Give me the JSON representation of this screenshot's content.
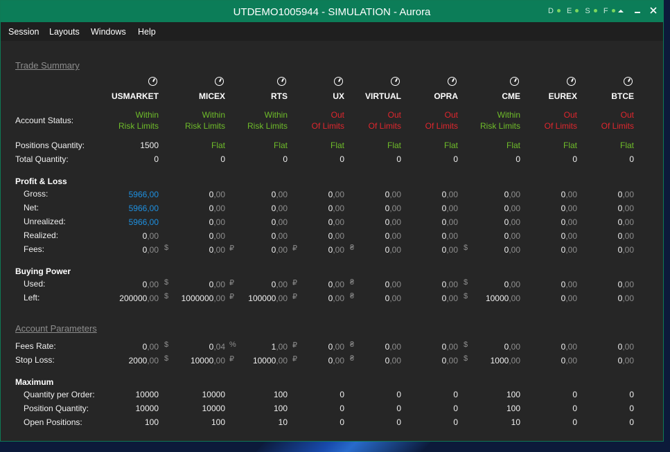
{
  "window": {
    "title": "UTDEMO1005944 - SIMULATION - Aurora",
    "lights": [
      "D",
      "E",
      "S",
      "F"
    ]
  },
  "menu": [
    "Session",
    "Layouts",
    "Windows",
    "Help"
  ],
  "sections": {
    "trade_summary": "Trade Summary",
    "account_parameters": "Account Parameters"
  },
  "exchanges": [
    "USMARKET",
    "MICEX",
    "RTS",
    "UX",
    "VIRTUAL",
    "OPRA",
    "CME",
    "EUREX",
    "BTCE"
  ],
  "labels": {
    "account_status": "Account Status:",
    "positions_quantity": "Positions Quantity:",
    "total_quantity": "Total Quantity:",
    "profit_loss": "Profit & Loss",
    "gross": "Gross:",
    "net": "Net:",
    "unrealized": "Unrealized:",
    "realized": "Realized:",
    "fees": "Fees:",
    "buying_power": "Buying Power",
    "used": "Used:",
    "left": "Left:",
    "fees_rate": "Fees Rate:",
    "stop_loss": "Stop Loss:",
    "maximum": "Maximum",
    "qty_per_order": "Quantity per Order:",
    "position_quantity": "Position Quantity:",
    "open_positions": "Open Positions:"
  },
  "account_status": [
    {
      "l1": "Within",
      "l2": "Risk Limits",
      "color": "green"
    },
    {
      "l1": "Within",
      "l2": "Risk Limits",
      "color": "green"
    },
    {
      "l1": "Within",
      "l2": "Risk Limits",
      "color": "green"
    },
    {
      "l1": "Out",
      "l2": "Of Limits",
      "color": "red"
    },
    {
      "l1": "Out",
      "l2": "Of Limits",
      "color": "red"
    },
    {
      "l1": "Out",
      "l2": "Of Limits",
      "color": "red"
    },
    {
      "l1": "Within",
      "l2": "Risk Limits",
      "color": "green"
    },
    {
      "l1": "Out",
      "l2": "Of Limits",
      "color": "red"
    },
    {
      "l1": "Out",
      "l2": "Of Limits",
      "color": "red"
    }
  ],
  "positions_quantity": [
    {
      "v": "1500",
      "color": "white"
    },
    {
      "v": "Flat",
      "color": "green"
    },
    {
      "v": "Flat",
      "color": "green"
    },
    {
      "v": "Flat",
      "color": "green"
    },
    {
      "v": "Flat",
      "color": "green"
    },
    {
      "v": "Flat",
      "color": "green"
    },
    {
      "v": "Flat",
      "color": "green"
    },
    {
      "v": "Flat",
      "color": "green"
    },
    {
      "v": "Flat",
      "color": "green"
    }
  ],
  "total_quantity": [
    "0",
    "0",
    "0",
    "0",
    "0",
    "0",
    "0",
    "0",
    "0"
  ],
  "gross": [
    {
      "i": "5966",
      "d": ",00",
      "c": "blue"
    },
    {
      "i": "0",
      "d": ",00"
    },
    {
      "i": "0",
      "d": ",00"
    },
    {
      "i": "0",
      "d": ",00"
    },
    {
      "i": "0",
      "d": ",00"
    },
    {
      "i": "0",
      "d": ",00"
    },
    {
      "i": "0",
      "d": ",00"
    },
    {
      "i": "0",
      "d": ",00"
    },
    {
      "i": "0",
      "d": ",00"
    }
  ],
  "net": [
    {
      "i": "5966",
      "d": ",00",
      "c": "blue"
    },
    {
      "i": "0",
      "d": ",00"
    },
    {
      "i": "0",
      "d": ",00"
    },
    {
      "i": "0",
      "d": ",00"
    },
    {
      "i": "0",
      "d": ",00"
    },
    {
      "i": "0",
      "d": ",00"
    },
    {
      "i": "0",
      "d": ",00"
    },
    {
      "i": "0",
      "d": ",00"
    },
    {
      "i": "0",
      "d": ",00"
    }
  ],
  "unrealized": [
    {
      "i": "5966",
      "d": ",00",
      "c": "blue"
    },
    {
      "i": "0",
      "d": ",00"
    },
    {
      "i": "0",
      "d": ",00"
    },
    {
      "i": "0",
      "d": ",00"
    },
    {
      "i": "0",
      "d": ",00"
    },
    {
      "i": "0",
      "d": ",00"
    },
    {
      "i": "0",
      "d": ",00"
    },
    {
      "i": "0",
      "d": ",00"
    },
    {
      "i": "0",
      "d": ",00"
    }
  ],
  "realized": [
    {
      "i": "0",
      "d": ",00"
    },
    {
      "i": "0",
      "d": ",00"
    },
    {
      "i": "0",
      "d": ",00"
    },
    {
      "i": "0",
      "d": ",00"
    },
    {
      "i": "0",
      "d": ",00"
    },
    {
      "i": "0",
      "d": ",00"
    },
    {
      "i": "0",
      "d": ",00"
    },
    {
      "i": "0",
      "d": ",00"
    },
    {
      "i": "0",
      "d": ",00"
    }
  ],
  "fees": [
    {
      "i": "0",
      "d": ",00",
      "u": "$"
    },
    {
      "i": "0",
      "d": ",00",
      "u": "₽"
    },
    {
      "i": "0",
      "d": ",00",
      "u": "₽"
    },
    {
      "i": "0",
      "d": ",00",
      "u": "₴"
    },
    {
      "i": "0",
      "d": ",00"
    },
    {
      "i": "0",
      "d": ",00",
      "u": "$"
    },
    {
      "i": "0",
      "d": ",00"
    },
    {
      "i": "0",
      "d": ",00"
    },
    {
      "i": "0",
      "d": ",00"
    }
  ],
  "used": [
    {
      "i": "0",
      "d": ",00",
      "u": "$"
    },
    {
      "i": "0",
      "d": ",00",
      "u": "₽"
    },
    {
      "i": "0",
      "d": ",00",
      "u": "₽"
    },
    {
      "i": "0",
      "d": ",00",
      "u": "₴"
    },
    {
      "i": "0",
      "d": ",00"
    },
    {
      "i": "0",
      "d": ",00",
      "u": "$"
    },
    {
      "i": "0",
      "d": ",00"
    },
    {
      "i": "0",
      "d": ",00"
    },
    {
      "i": "0",
      "d": ",00"
    }
  ],
  "left": [
    {
      "i": "200000",
      "d": ",00",
      "u": "$"
    },
    {
      "i": "1000000",
      "d": ",00",
      "u": "₽"
    },
    {
      "i": "100000",
      "d": ",00",
      "u": "₽"
    },
    {
      "i": "0",
      "d": ",00",
      "u": "₴"
    },
    {
      "i": "0",
      "d": ",00"
    },
    {
      "i": "0",
      "d": ",00",
      "u": "$"
    },
    {
      "i": "10000",
      "d": ",00"
    },
    {
      "i": "0",
      "d": ",00"
    },
    {
      "i": "0",
      "d": ",00"
    }
  ],
  "fees_rate": [
    {
      "i": "0",
      "d": ",00",
      "u": "$"
    },
    {
      "i": "0",
      "d": ",04",
      "u": "%"
    },
    {
      "i": "1",
      "d": ",00",
      "u": "₽"
    },
    {
      "i": "0",
      "d": ",00",
      "u": "₴"
    },
    {
      "i": "0",
      "d": ",00"
    },
    {
      "i": "0",
      "d": ",00",
      "u": "$"
    },
    {
      "i": "0",
      "d": ",00"
    },
    {
      "i": "0",
      "d": ",00"
    },
    {
      "i": "0",
      "d": ",00"
    }
  ],
  "stop_loss": [
    {
      "i": "2000",
      "d": ",00",
      "u": "$"
    },
    {
      "i": "10000",
      "d": ",00",
      "u": "₽"
    },
    {
      "i": "10000",
      "d": ",00",
      "u": "₽"
    },
    {
      "i": "0",
      "d": ",00",
      "u": "₴"
    },
    {
      "i": "0",
      "d": ",00"
    },
    {
      "i": "0",
      "d": ",00",
      "u": "$"
    },
    {
      "i": "1000",
      "d": ",00"
    },
    {
      "i": "0",
      "d": ",00"
    },
    {
      "i": "0",
      "d": ",00"
    }
  ],
  "qty_per_order": [
    "10000",
    "10000",
    "100",
    "0",
    "0",
    "0",
    "100",
    "0",
    "0"
  ],
  "position_quantity": [
    "10000",
    "10000",
    "100",
    "0",
    "0",
    "0",
    "100",
    "0",
    "0"
  ],
  "open_positions": [
    "100",
    "100",
    "10",
    "0",
    "0",
    "0",
    "10",
    "0",
    "0"
  ]
}
